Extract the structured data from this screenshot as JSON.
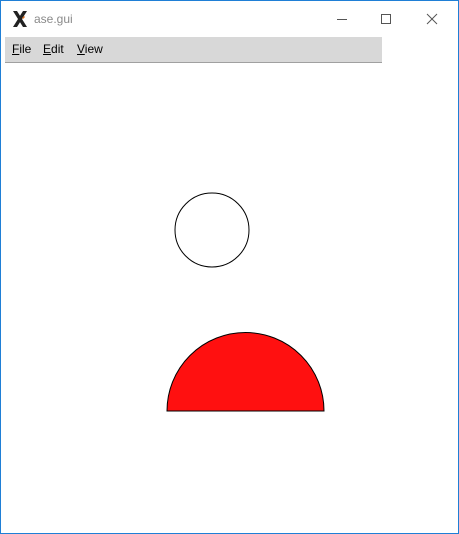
{
  "window": {
    "title": "ase.gui",
    "icon": "x-app-icon"
  },
  "controls": {
    "minimize": "minimize-icon",
    "maximize": "maximize-icon",
    "close": "close-icon"
  },
  "menubar": {
    "items": [
      {
        "label_first": "F",
        "label_rest": "ile"
      },
      {
        "label_first": "E",
        "label_rest": "dit"
      },
      {
        "label_first": "V",
        "label_rest": "iew"
      }
    ]
  },
  "drawing": {
    "circle_fill": "#ffffff",
    "circle_stroke": "#000000",
    "semicircle_fill": "#ff1010",
    "semicircle_stroke": "#000000"
  },
  "colors": {
    "border": "#1f7fd6",
    "menubar_bg": "#d8d8d8",
    "title_text": "#8a8a8a"
  }
}
